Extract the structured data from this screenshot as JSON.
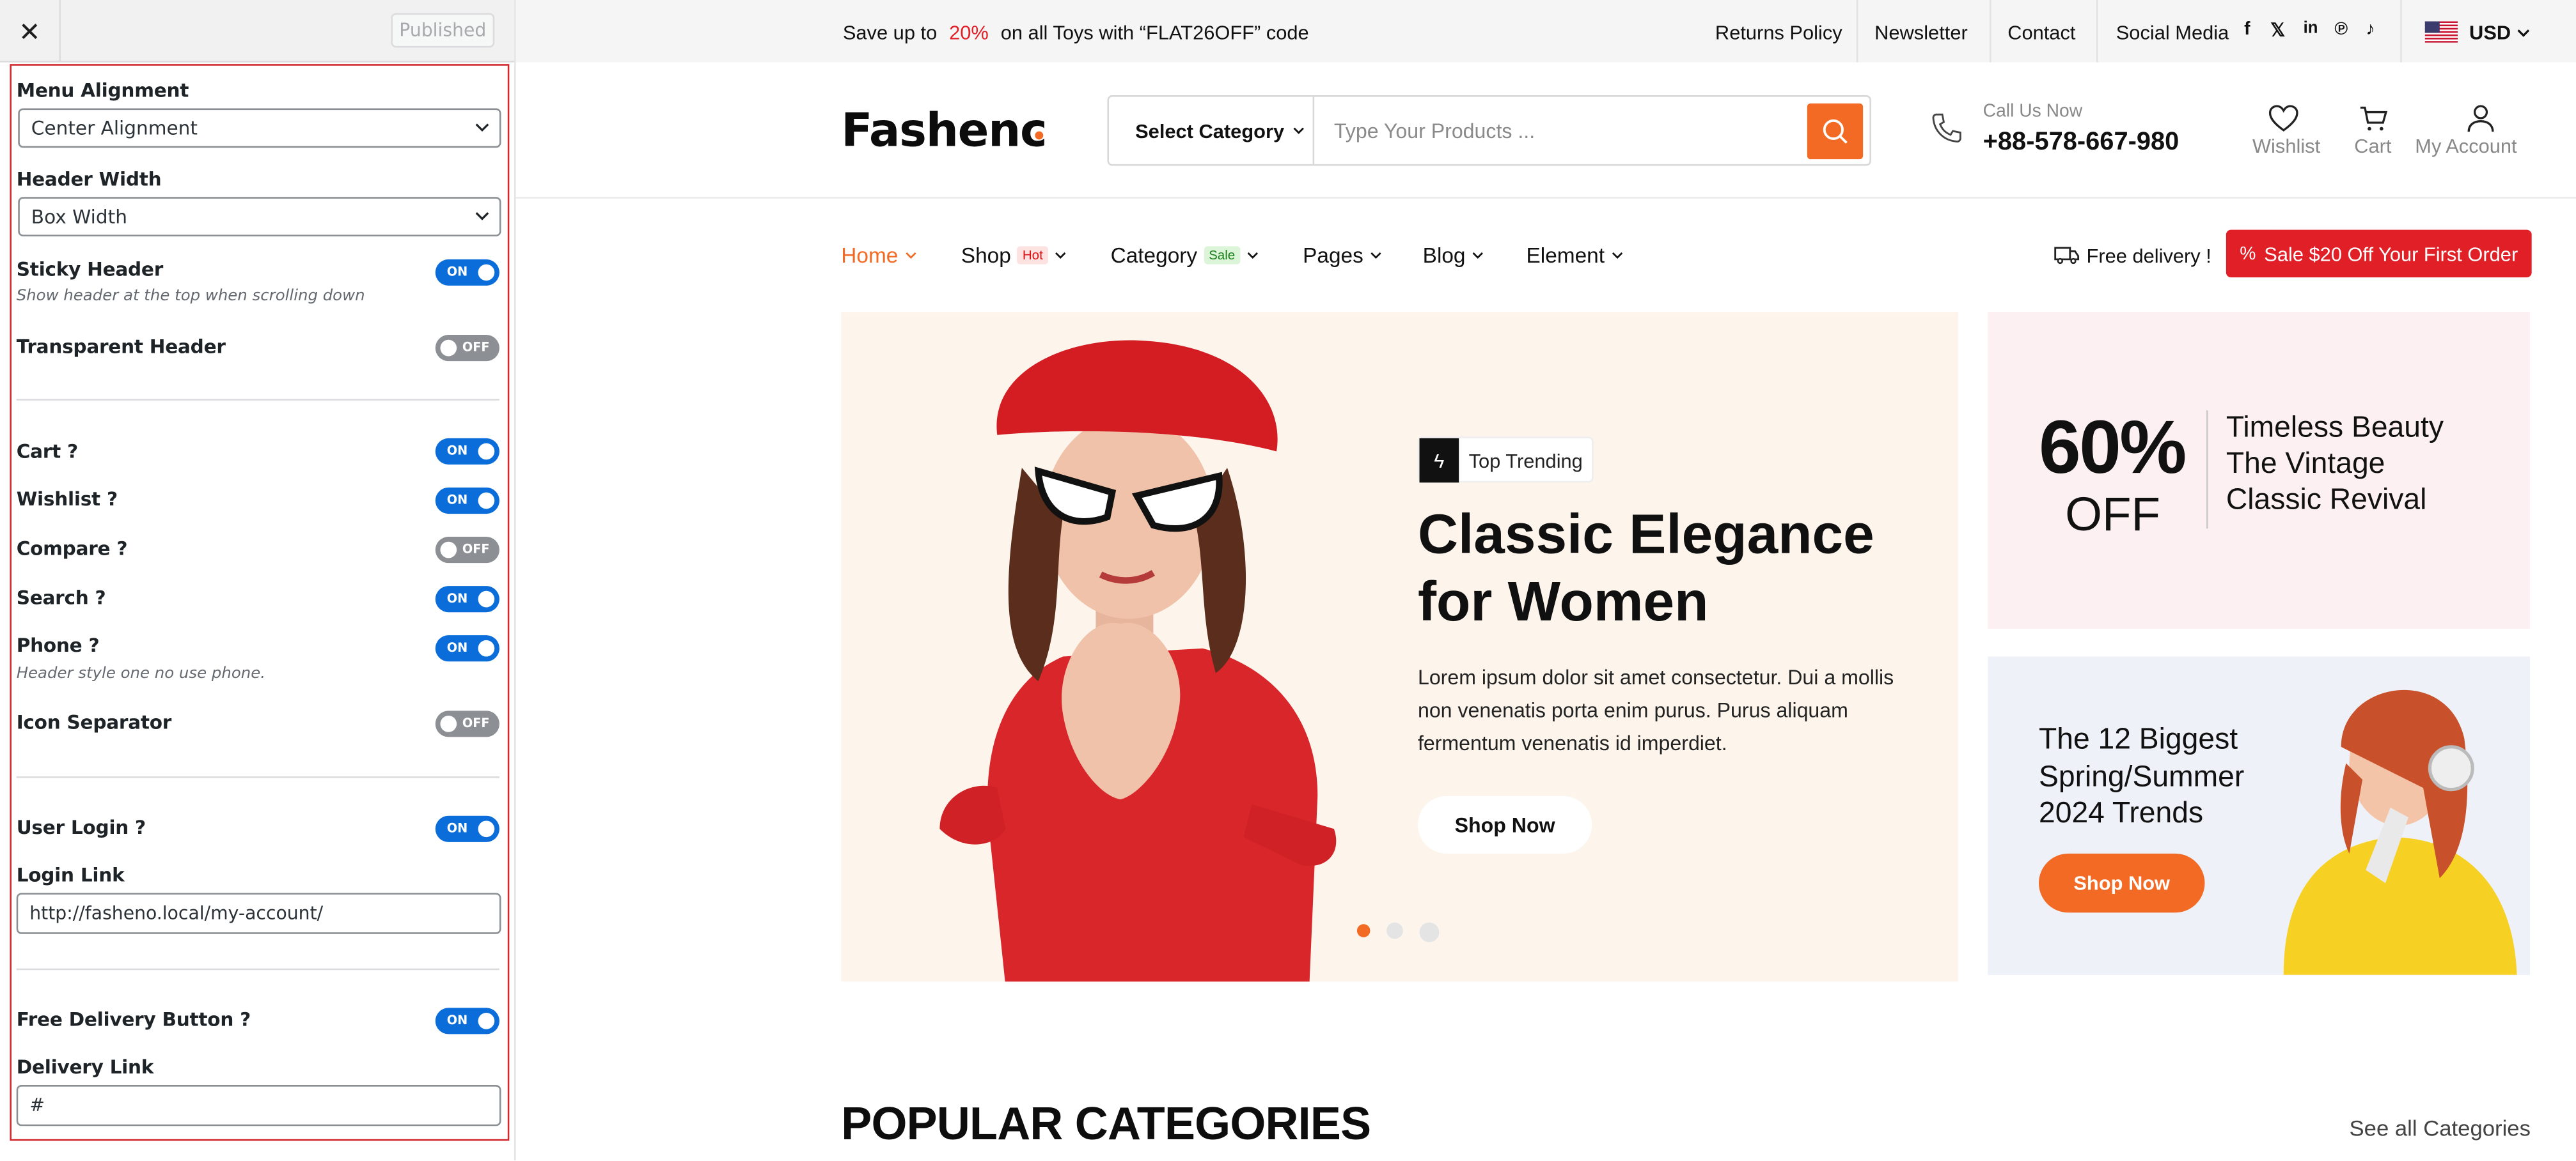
{
  "customizer": {
    "close_icon": "close-icon",
    "publish_label": "Published",
    "menu_alignment": {
      "label": "Menu Alignment",
      "value": "Center Alignment"
    },
    "header_width": {
      "label": "Header Width",
      "value": "Box Width"
    },
    "sticky_header": {
      "label": "Sticky Header",
      "hint": "Show header at the top when scrolling down",
      "state": "ON"
    },
    "transparent_header": {
      "label": "Transparent Header",
      "state": "OFF"
    },
    "cart": {
      "label": "Cart ?",
      "state": "ON"
    },
    "wishlist": {
      "label": "Wishlist ?",
      "state": "ON"
    },
    "compare": {
      "label": "Compare ?",
      "state": "OFF"
    },
    "search": {
      "label": "Search ?",
      "state": "ON"
    },
    "phone": {
      "label": "Phone ?",
      "hint": "Header style one no use phone.",
      "state": "ON"
    },
    "icon_separator": {
      "label": "Icon Separator",
      "state": "OFF"
    },
    "user_login": {
      "label": "User Login ?",
      "state": "ON"
    },
    "login_link": {
      "label": "Login Link",
      "value": "http://fasheno.local/my-account/"
    },
    "free_delivery": {
      "label": "Free Delivery Button ?",
      "state": "ON"
    },
    "delivery_link": {
      "label": "Delivery Link",
      "value": "#"
    }
  },
  "topbar": {
    "promo_pre": "Save up to",
    "promo_pct": "20%",
    "promo_post": "on all Toys with “FLAT26OFF” code",
    "links": [
      "Returns Policy",
      "Newsletter",
      "Contact",
      "Social Media"
    ],
    "social_icons": [
      "facebook-icon",
      "x-icon",
      "linkedin-icon",
      "pinterest-icon",
      "tiktok-icon"
    ],
    "currency": "USD"
  },
  "header": {
    "logo": "Fashenc",
    "category_select": "Select Category",
    "search_placeholder": "Type Your Products ...",
    "call_label": "Call Us Now",
    "phone": "+88-578-667-980",
    "wishlist": "Wishlist",
    "cart": "Cart",
    "account": "My Account"
  },
  "nav": {
    "items": [
      {
        "label": "Home"
      },
      {
        "label": "Shop",
        "badge": "Hot"
      },
      {
        "label": "Category",
        "badge": "Sale"
      },
      {
        "label": "Pages"
      },
      {
        "label": "Blog"
      },
      {
        "label": "Element"
      }
    ],
    "free_delivery": "Free delivery !",
    "sale_button": "Sale $20 Off Your First Order"
  },
  "hero": {
    "tag": "Top Trending",
    "title_line1": "Classic Elegance",
    "title_line2": "for Women",
    "body_line1": "Lorem ipsum dolor sit amet consectetur. Dui a mollis",
    "body_line2": "non venenatis porta enim purus. Purus aliquam",
    "body_line3": "fermentum venenatis id imperdiet.",
    "button": "Shop Now",
    "slides": 3,
    "active_slide": 1
  },
  "promo1": {
    "pct": "60%",
    "off": "OFF",
    "line1": "Timeless Beauty",
    "line2": "The Vintage",
    "line3": "Classic Revival"
  },
  "promo2": {
    "line1": "The 12 Biggest",
    "line2": "Spring/Summer",
    "line3": "2024 Trends",
    "button": "Shop Now"
  },
  "section": {
    "title": "POPULAR CATEGORIES",
    "link": "See all Categories"
  },
  "colors": {
    "accent": "#f26a24",
    "sale": "#e11f26",
    "toggle_on": "#0a6dd9",
    "panel_border": "#d3272e"
  }
}
